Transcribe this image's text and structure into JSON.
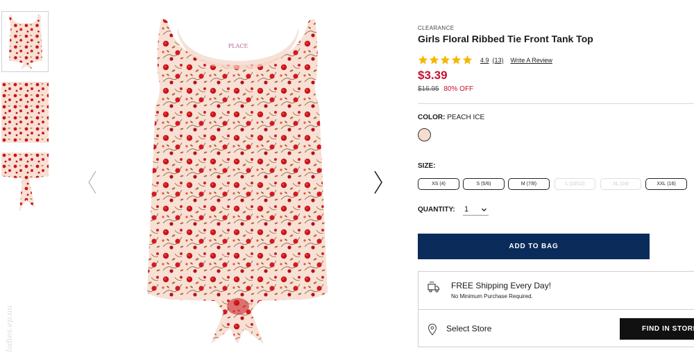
{
  "product": {
    "eyebrow": "CLEARANCE",
    "title": "Girls Floral Ribbed Tie Front Tank Top",
    "rating": "4.9",
    "rating_stars": 5,
    "review_count": "(13)",
    "write_review": "Write A Review",
    "price": "$3.39",
    "original_price": "$16.95",
    "discount": "80% OFF",
    "label_badge": "PLACE"
  },
  "color": {
    "label": "COLOR:",
    "value": "PEACH ICE",
    "swatch_hex": "#f7dcd0"
  },
  "size": {
    "label": "SIZE:",
    "options": [
      {
        "label": "XS (4)",
        "available": true
      },
      {
        "label": "S (5/6)",
        "available": true
      },
      {
        "label": "M (7/8)",
        "available": true
      },
      {
        "label": "L (10/12)",
        "available": false
      },
      {
        "label": "XL (14)",
        "available": false
      },
      {
        "label": "XXL (16)",
        "available": true
      }
    ]
  },
  "quantity": {
    "label": "QUANTITY:",
    "value": "1"
  },
  "actions": {
    "add_to_bag": "ADD TO BAG",
    "find_in_store": "FIND IN STORE"
  },
  "shipping": {
    "title": "FREE Shipping Every Day!",
    "subtitle": "No Minimum Purchase Required.",
    "select_store": "Select Store"
  },
  "colors": {
    "price_red": "#c8102e",
    "cta_navy": "#0b2c5a",
    "store_black": "#111111",
    "star_gold": "#f5b800"
  },
  "icons": [
    "chevron-left-icon",
    "chevron-right-icon",
    "star-icon",
    "chevron-down-icon",
    "truck-icon",
    "location-pin-icon"
  ]
}
